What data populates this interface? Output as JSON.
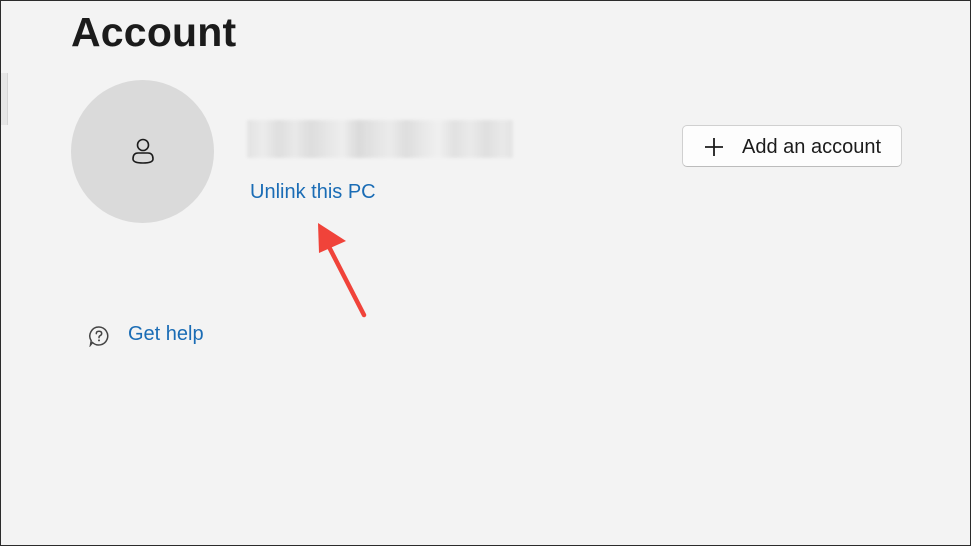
{
  "page": {
    "title": "Account"
  },
  "account": {
    "avatar_icon": "person-icon",
    "email_redacted": true,
    "unlink_label": "Unlink this PC"
  },
  "actions": {
    "add_account_label": "Add an account",
    "add_account_icon": "plus-icon"
  },
  "help": {
    "label": "Get help",
    "icon": "question-bubble-icon"
  },
  "annotation": {
    "type": "arrow",
    "color": "#f0433a",
    "points_to": "Unlink this PC"
  },
  "colors": {
    "background": "#f3f3f3",
    "link": "#1a6cb5",
    "avatar_bg": "#dadada",
    "text": "#1b1b1b"
  }
}
